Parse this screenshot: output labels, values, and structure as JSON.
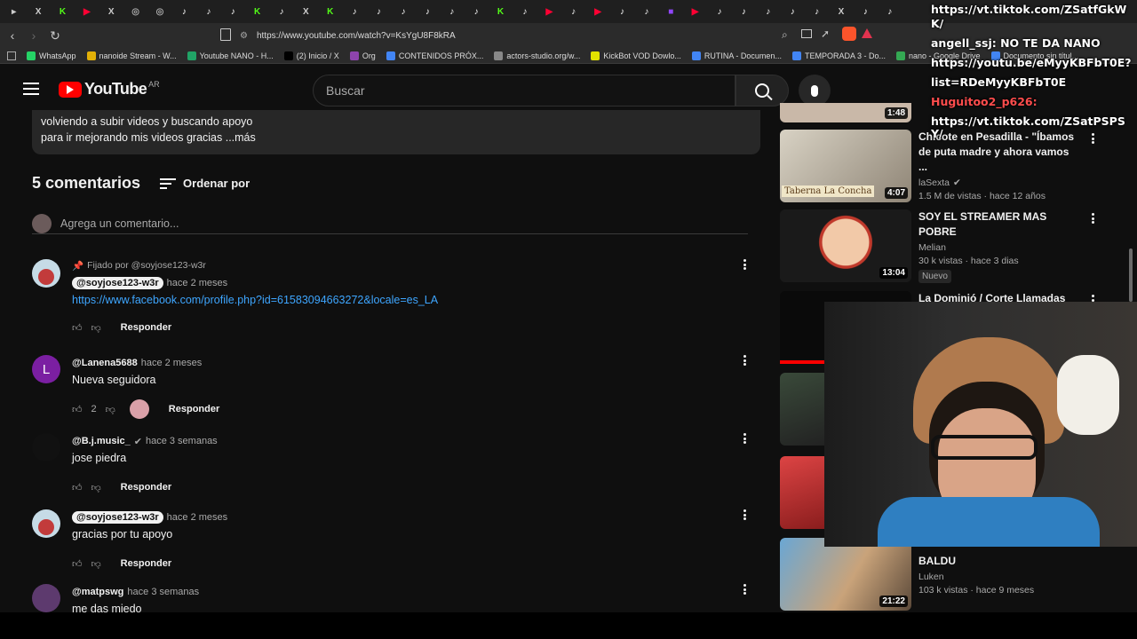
{
  "browser": {
    "url": "https://www.youtube.com/watch?v=KsYgU8F8kRA",
    "tabs": [
      "mute",
      "X",
      "K",
      "yt",
      "X",
      "gh",
      "gh",
      "tt",
      "tt",
      "tt",
      "K",
      "tt",
      "X",
      "K",
      "tt",
      "tt",
      "tt",
      "tt",
      "tt",
      "tt",
      "K",
      "tt",
      "yt",
      "tt",
      "yt",
      "tt",
      "tt",
      "tw",
      "yt",
      "tt",
      "tt",
      "tt",
      "tt",
      "tt",
      "X",
      "tt",
      "tt"
    ],
    "bookmarks": [
      {
        "label": "WhatsApp",
        "color": "#25d366"
      },
      {
        "label": "nanoide Stream - W...",
        "color": "#e2b007"
      },
      {
        "label": "Youtube NANO - H...",
        "color": "#21a366"
      },
      {
        "label": "(2) Inicio / X",
        "color": "#000000"
      },
      {
        "label": "Org",
        "color": "#8e44ad"
      },
      {
        "label": "CONTENIDOS PRÓX...",
        "color": "#4285f4"
      },
      {
        "label": "actors-studio.org/w...",
        "color": "#888888"
      },
      {
        "label": "KickBot VOD Dowlo...",
        "color": "#e2e200"
      },
      {
        "label": "RUTINA - Documen...",
        "color": "#4285f4"
      },
      {
        "label": "TEMPORADA 3 - Do...",
        "color": "#4285f4"
      },
      {
        "label": "nano - Google Drive",
        "color": "#34a853"
      },
      {
        "label": "Documento sin títul...",
        "color": "#4285f4"
      }
    ]
  },
  "youtube": {
    "logo": "YouTube",
    "region": "AR",
    "search_placeholder": "Buscar"
  },
  "description": {
    "line1": "volviendo a subir videos y buscando apoyo",
    "line2": "para ir mejorando mis videos  gracias ...más"
  },
  "comments_section": {
    "count_label": "5 comentarios",
    "sort_label": "Ordenar por",
    "add_placeholder": "Agrega un comentario...",
    "reply_label": "Responder",
    "comments": [
      {
        "pinned_label": "Fijado por @soyjose123-w3r",
        "author": "@soyjose123-w3r",
        "time": "hace 2 meses",
        "text": "https://www.facebook.com/profile.php?id=61583094663272&locale=es_LA",
        "likes": ""
      },
      {
        "author": "@Lanena5688",
        "avatar_letter": "L",
        "time": "hace 2 meses",
        "text": "Nueva seguidora",
        "likes": "2"
      },
      {
        "author": "@B.j.music_",
        "time": "hace 3 semanas",
        "text": "jose piedra",
        "likes": ""
      },
      {
        "author": "@soyjose123-w3r",
        "time": "hace 2 meses",
        "text": "gracias por tu apoyo",
        "likes": ""
      },
      {
        "author": "@matpswg",
        "time": "hace 3 semanas",
        "text": "me das miedo",
        "likes": ""
      }
    ]
  },
  "sidebar_videos": [
    {
      "duration": "1:48"
    },
    {
      "title": "Chicote en Pesadilla - \"Íbamos de puta madre y ahora vamos ...",
      "channel": "laSexta",
      "stats": "1.5 M de vistas · hace 12 años",
      "duration": "4:07",
      "thumb_text": "Taberna La Concha"
    },
    {
      "title": "SOY EL STREAMER MAS POBRE",
      "channel": "Melian",
      "stats": "30 k vistas · hace 3 dias",
      "duration": "13:04",
      "badge": "Nuevo"
    },
    {
      "title": "La Dominió / Corte Llamadas"
    },
    {
      "title": "BALDU",
      "channel": "Luken",
      "stats": "103 k vistas · hace 9 meses",
      "duration": "21:22"
    }
  ],
  "chat_overlay": [
    "https://vt.tiktok.com/ZSatfGkW",
    "K/",
    "angell_ssj: NO TE DA NANO",
    "https://youtu.be/eMyyKBFbT0E?",
    "list=RDeMyyKBFbT0E",
    "Huguitoo2_p626:",
    "https://vt.tiktok.com/ZSatPSPS",
    "Y/"
  ]
}
